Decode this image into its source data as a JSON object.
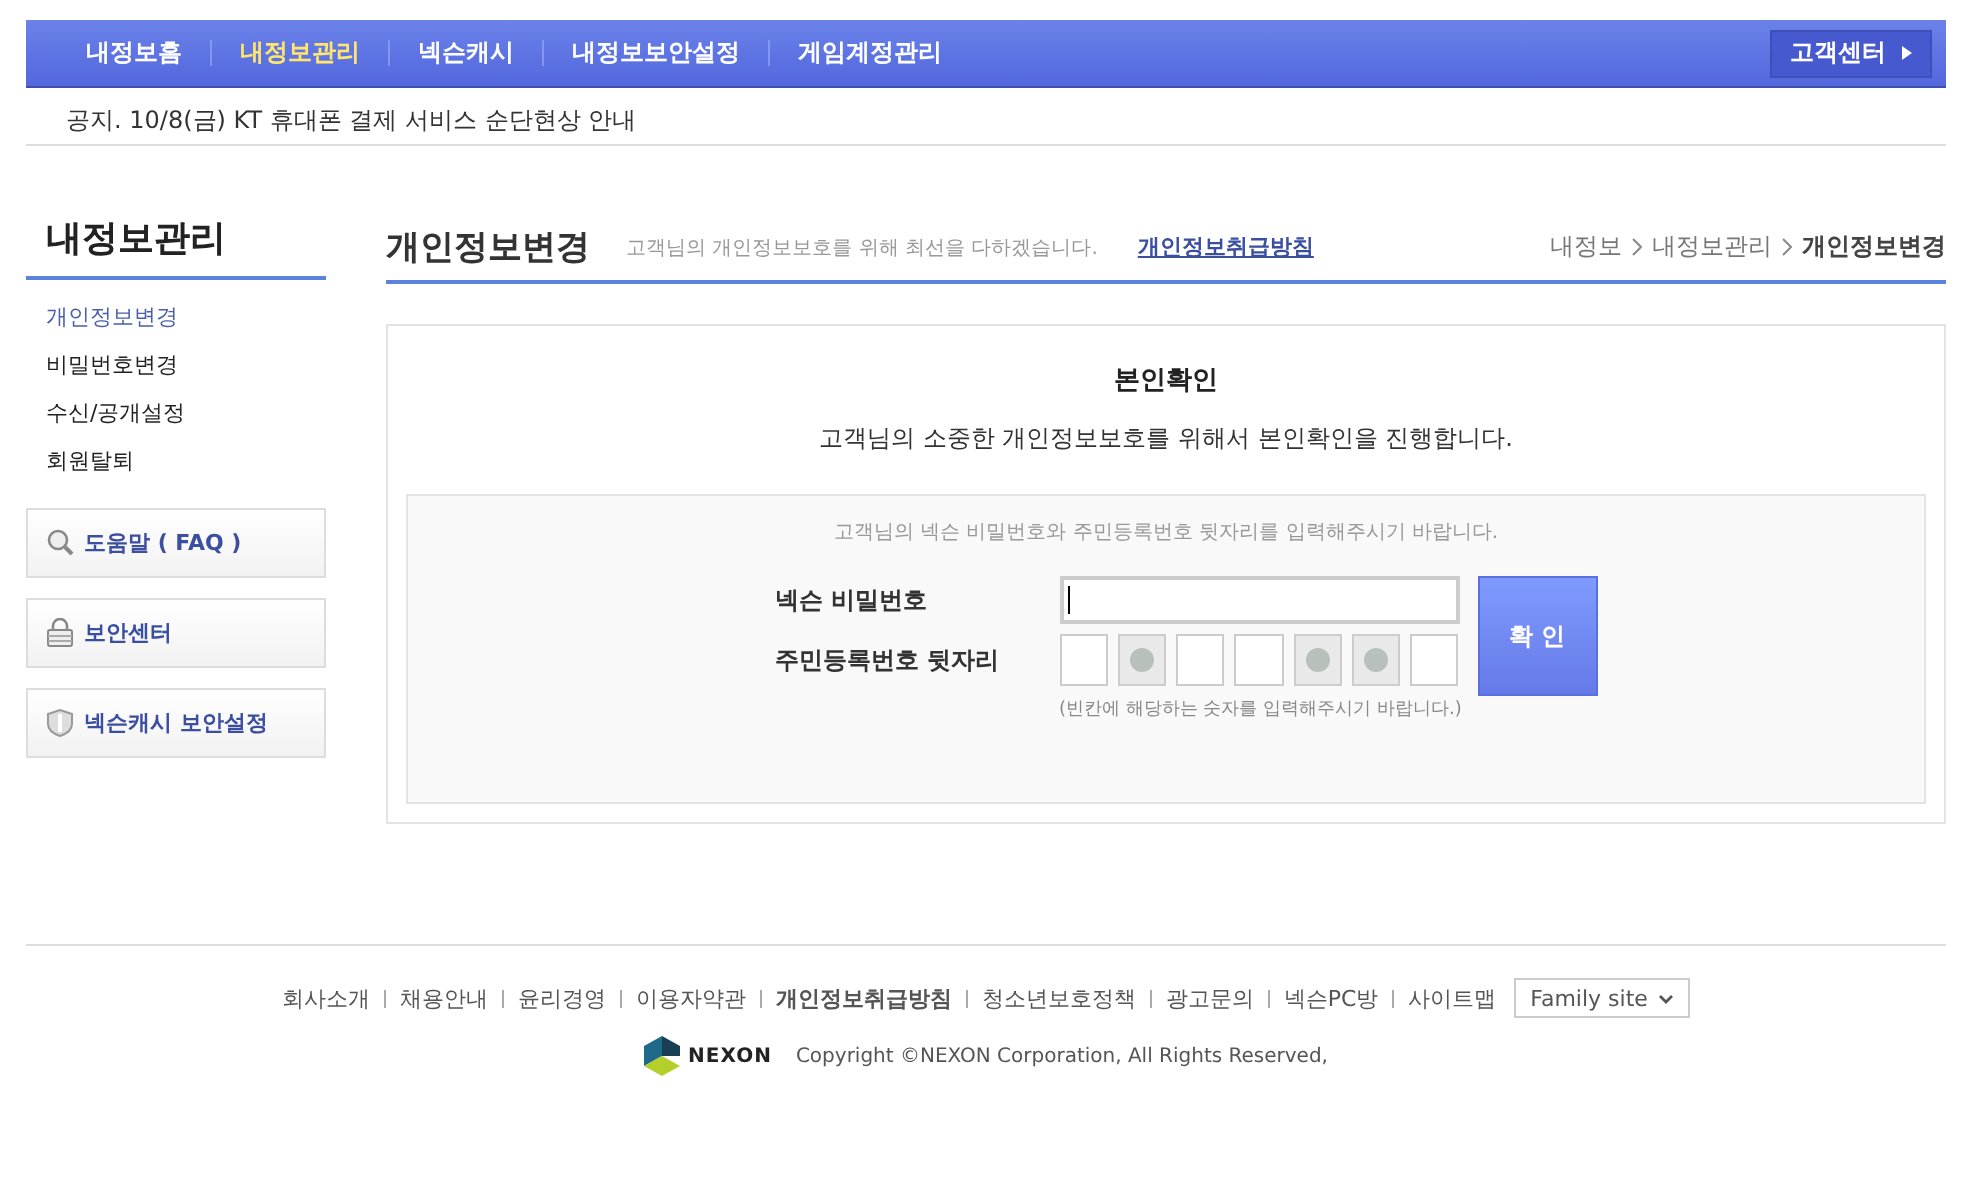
{
  "nav": {
    "items": [
      {
        "label": "내정보홈",
        "selected": false
      },
      {
        "label": "내정보관리",
        "selected": true
      },
      {
        "label": "넥슨캐시",
        "selected": false
      },
      {
        "label": "내정보보안설정",
        "selected": false
      },
      {
        "label": "게임계정관리",
        "selected": false
      }
    ],
    "support_button": "고객센터"
  },
  "notice": "공지. 10/8(금) KT 휴대폰 결제 서비스 순단현상 안내",
  "sidebar": {
    "title": "내정보관리",
    "items": [
      {
        "label": "개인정보변경",
        "selected": true
      },
      {
        "label": "비밀번호변경",
        "selected": false
      },
      {
        "label": "수신/공개설정",
        "selected": false
      },
      {
        "label": "회원탈퇴",
        "selected": false
      }
    ],
    "boxes": [
      {
        "kind": "search",
        "label": "도움말 ( FAQ )"
      },
      {
        "kind": "lock",
        "label": "보안센터"
      },
      {
        "kind": "shield",
        "label": "넥슨캐시 보안설정"
      }
    ]
  },
  "page": {
    "title": "개인정보변경",
    "subtitle": "고객님의 개인정보보호를 위해 최선을 다하겠습니다.",
    "policy_link": "개인정보취급방침",
    "breadcrumb": [
      {
        "label": "내정보",
        "current": false
      },
      {
        "label": "내정보관리",
        "current": false
      },
      {
        "label": "개인정보변경",
        "current": true
      }
    ]
  },
  "verify": {
    "title": "본인확인",
    "intro": "고객님의 소중한 개인정보보호를 위해서 본인확인을 진행합니다.",
    "instruction": "고객님의 넥슨 비밀번호와 주민등록번호 뒷자리를 입력해주시기 바랍니다.",
    "password_label": "넥슨 비밀번호",
    "id_label": "주민등록번호 뒷자리",
    "digits": [
      {
        "masked": false
      },
      {
        "masked": true
      },
      {
        "masked": false
      },
      {
        "masked": false
      },
      {
        "masked": true
      },
      {
        "masked": true
      },
      {
        "masked": false
      }
    ],
    "hint": "(빈칸에 해당하는 숫자를 입력해주시기 바랍니다.)",
    "confirm_button": "확 인"
  },
  "footer": {
    "links": [
      {
        "label": "회사소개",
        "bold": false
      },
      {
        "label": "채용안내",
        "bold": false
      },
      {
        "label": "윤리경영",
        "bold": false
      },
      {
        "label": "이용자약관",
        "bold": false
      },
      {
        "label": "개인정보취급방침",
        "bold": true
      },
      {
        "label": "청소년보호정책",
        "bold": false
      },
      {
        "label": "광고문의",
        "bold": false
      },
      {
        "label": "넥슨PC방",
        "bold": false
      },
      {
        "label": "사이트맵",
        "bold": false
      }
    ],
    "family_site": "Family site",
    "logo": "NEXON",
    "copyright": "Copyright ©NEXON Corporation, All Rights Reserved,"
  }
}
